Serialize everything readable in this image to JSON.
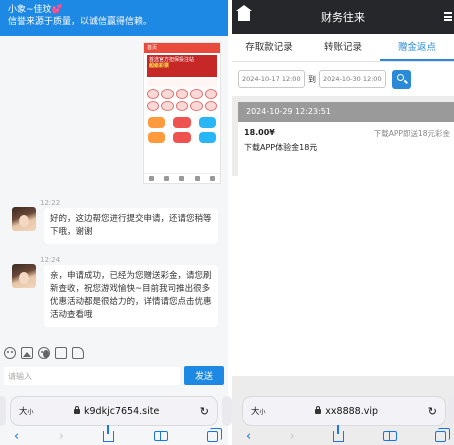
{
  "left": {
    "chat": {
      "agent_name": "小象~佳玟",
      "agent_heart": "💕",
      "slogan": "信誉来源于质量，以诚信赢得信赖。"
    },
    "screenshot_attachment": {
      "top_bar_text": "首页",
      "banner_line1": "首选官方担保投注站",
      "banner_line2": "超级彩票"
    },
    "messages": [
      {
        "time": "12:22",
        "text": "好的，这边帮您进行提交申请，还请您稍等下哦，谢谢"
      },
      {
        "time": "12:24",
        "text": "亲，申请成功，已经为您赠送彩金，请您刷新查收，祝您游戏愉快~目前我司推出很多优惠活动都是很给力的，详情请您点击优惠活动查看哦"
      }
    ],
    "composer": {
      "placeholder": "请输入",
      "send_label": "发送"
    },
    "browser": {
      "aa_large": "大",
      "aa_small": "小",
      "domain": "k9dkjc7654.site",
      "reload_glyph": "↻"
    }
  },
  "right": {
    "header": {
      "title": "财务往来"
    },
    "tabs": [
      {
        "label": "存取款记录",
        "active": false
      },
      {
        "label": "转账记录",
        "active": false
      },
      {
        "label": "赠金返点",
        "active": true
      }
    ],
    "filter": {
      "start_date": "2024-10-17 12:00",
      "separator": "到",
      "end_date": "2024-10-30 12:00"
    },
    "record": {
      "datetime": "2024-10-29 12:23:51",
      "amount": "18.00¥",
      "type": "下载APP即送18元彩金",
      "description": "下载APP体验金18元"
    },
    "browser": {
      "aa_large": "大",
      "aa_small": "小",
      "domain": "xx8888.vip",
      "reload_glyph": "↻"
    }
  },
  "toolbar": {
    "back_glyph": "‹",
    "forward_glyph": "›"
  },
  "colors": {
    "chat_header": "#1e88e5",
    "send_button": "#1e88e5",
    "finance_header": "#26272b",
    "active_tab": "#2b8ad8",
    "record_date_bar": "#9a9a9a"
  }
}
